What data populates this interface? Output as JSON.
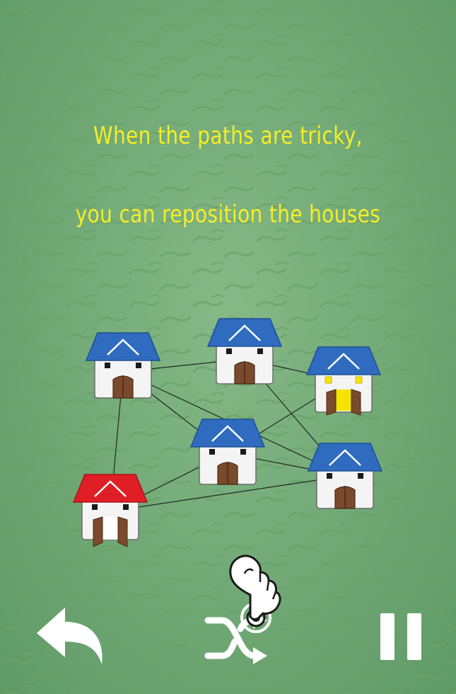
{
  "hint": {
    "line1": "When the paths are tricky,",
    "line2": "you can reposition the houses"
  },
  "colors": {
    "background": "#74ab78",
    "text": "#f7ee2a",
    "roof_blue": "#2f6cc0",
    "roof_red": "#e01e26",
    "wall": "#f4f4f4",
    "door": "#7a4a2c",
    "lit_window": "#f5e400"
  },
  "houses": [
    {
      "id": "top-left",
      "roof": "blue",
      "state": "closed"
    },
    {
      "id": "top-center",
      "roof": "blue",
      "state": "closed"
    },
    {
      "id": "top-right",
      "roof": "blue",
      "state": "open-lit"
    },
    {
      "id": "center",
      "roof": "blue",
      "state": "closed"
    },
    {
      "id": "right",
      "roof": "blue",
      "state": "closed"
    },
    {
      "id": "bottom-left",
      "roof": "red",
      "state": "open"
    }
  ],
  "paths": [
    [
      "top-left",
      "top-center"
    ],
    [
      "top-left",
      "center"
    ],
    [
      "top-left",
      "right"
    ],
    [
      "top-left",
      "bottom-left"
    ],
    [
      "top-center",
      "top-right"
    ],
    [
      "top-center",
      "right"
    ],
    [
      "top-right",
      "center"
    ],
    [
      "center",
      "right"
    ],
    [
      "center",
      "bottom-left"
    ],
    [
      "right",
      "bottom-left"
    ]
  ],
  "controls": {
    "undo_icon": "undo-arrow-icon",
    "shuffle_icon": "shuffle-icon",
    "pause_icon": "pause-icon",
    "hint_pointer_icon": "tap-hand-icon"
  }
}
